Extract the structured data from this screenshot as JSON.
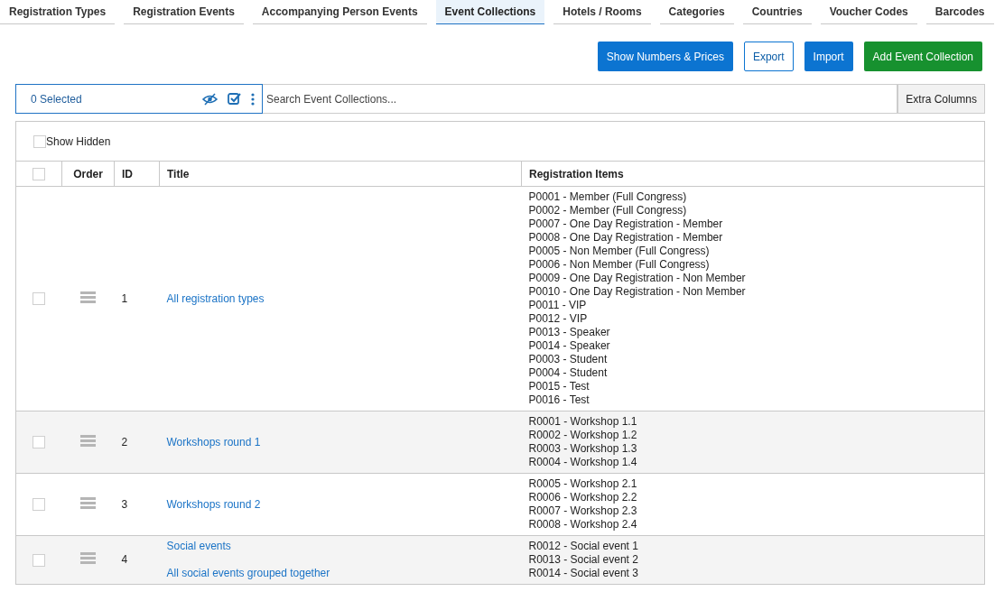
{
  "tabs": [
    {
      "label": "Registration Types",
      "selected": false
    },
    {
      "label": "Registration Events",
      "selected": false
    },
    {
      "label": "Accompanying Person Events",
      "selected": false
    },
    {
      "label": "Event Collections",
      "selected": true
    },
    {
      "label": "Hotels / Rooms",
      "selected": false
    },
    {
      "label": "Categories",
      "selected": false
    },
    {
      "label": "Countries",
      "selected": false
    },
    {
      "label": "Voucher Codes",
      "selected": false
    },
    {
      "label": "Barcodes",
      "selected": false
    }
  ],
  "actions": [
    {
      "label": "Show Numbers & Prices",
      "kind": "primary"
    },
    {
      "label": "Export",
      "kind": "outline"
    },
    {
      "label": "Import",
      "kind": "primary"
    },
    {
      "label": "Add Event Collection",
      "kind": "success"
    }
  ],
  "toolbar": {
    "selected_count": "0 Selected",
    "search": {
      "placeholder": "Search Event Collections..."
    },
    "extra_columns": "Extra Columns"
  },
  "show_hidden": {
    "label": "Show Hidden",
    "checked": false
  },
  "table": {
    "select_all": {
      "checked": false
    },
    "columns": [
      "Order",
      "ID",
      "Title",
      "Registration Items"
    ],
    "rows": [
      {
        "checked": false,
        "id": "1",
        "title": "All registration types",
        "items": [
          "P0001 - Member (Full Congress)",
          "P0002 - Member (Full Congress)",
          "P0007 - One Day Registration - Member",
          "P0008 - One Day Registration - Member",
          "P0005 - Non Member (Full Congress)",
          "P0006 - Non Member (Full Congress)",
          "P0009 - One Day Registration - Non Member",
          "P0010 - One Day Registration - Non Member",
          "P0011 - VIP",
          "P0012 - VIP",
          "P0013 - Speaker",
          "P0014 - Speaker",
          "P0003 - Student",
          "P0004 - Student",
          "P0015 - Test",
          "P0016 - Test"
        ]
      },
      {
        "checked": false,
        "id": "2",
        "title": "Workshops round 1",
        "items": [
          "R0001 - Workshop 1.1",
          "R0002 - Workshop 1.2",
          "R0003 - Workshop 1.3",
          "R0004 - Workshop 1.4"
        ]
      },
      {
        "checked": false,
        "id": "3",
        "title": "Workshops round 2",
        "items": [
          "R0005 - Workshop 2.1",
          "R0006 - Workshop 2.2",
          "R0007 - Workshop 2.3",
          "R0008 - Workshop 2.4"
        ]
      },
      {
        "checked": false,
        "id": "4",
        "title": "Social events",
        "description": "All social events grouped together",
        "items": [
          "R0012 - Social event 1",
          "R0013 - Social event 2",
          "R0014 - Social event 3"
        ]
      }
    ]
  }
}
